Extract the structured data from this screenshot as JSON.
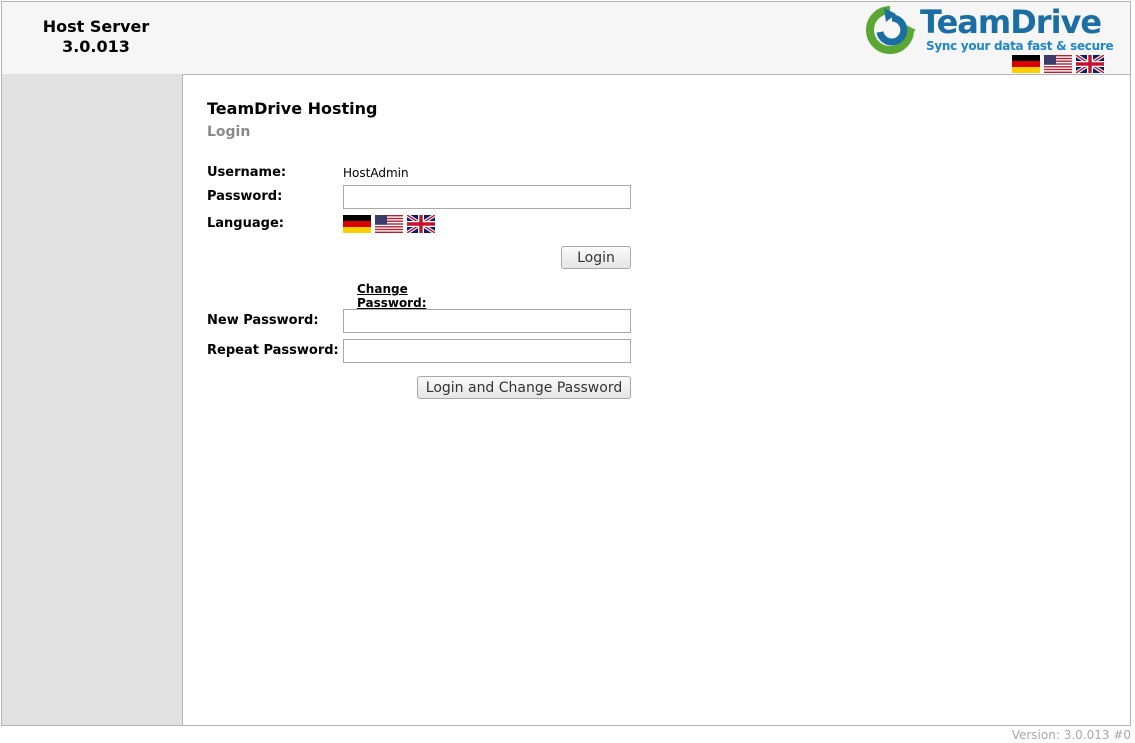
{
  "header": {
    "product_name": "Host Server",
    "version": "3.0.013",
    "logo_word": "TeamDrive",
    "logo_tagline": "Sync your data fast & secure",
    "flags": [
      "german-flag-icon",
      "us-flag-icon",
      "uk-flag-icon"
    ]
  },
  "main": {
    "title": "TeamDrive Hosting",
    "subtitle": "Login",
    "username_label": "Username:",
    "username_value": "HostAdmin",
    "password_label": "Password:",
    "password_value": "",
    "language_label": "Language:",
    "login_button": "Login",
    "change_password_link": "Change Password:",
    "new_password_label": "New Password:",
    "new_password_value": "",
    "repeat_password_label": "Repeat Password:",
    "repeat_password_value": "",
    "login_change_button": "Login and Change Password"
  },
  "footer": {
    "version_text": "Version: 3.0.013 #0"
  },
  "colors": {
    "brand_blue": "#1b6ea3",
    "tagline_blue": "#1f86c8",
    "logo_green": "#5aa832",
    "sidebar_bg": "#e1e1e1",
    "header_bg": "#f6f6f6"
  }
}
